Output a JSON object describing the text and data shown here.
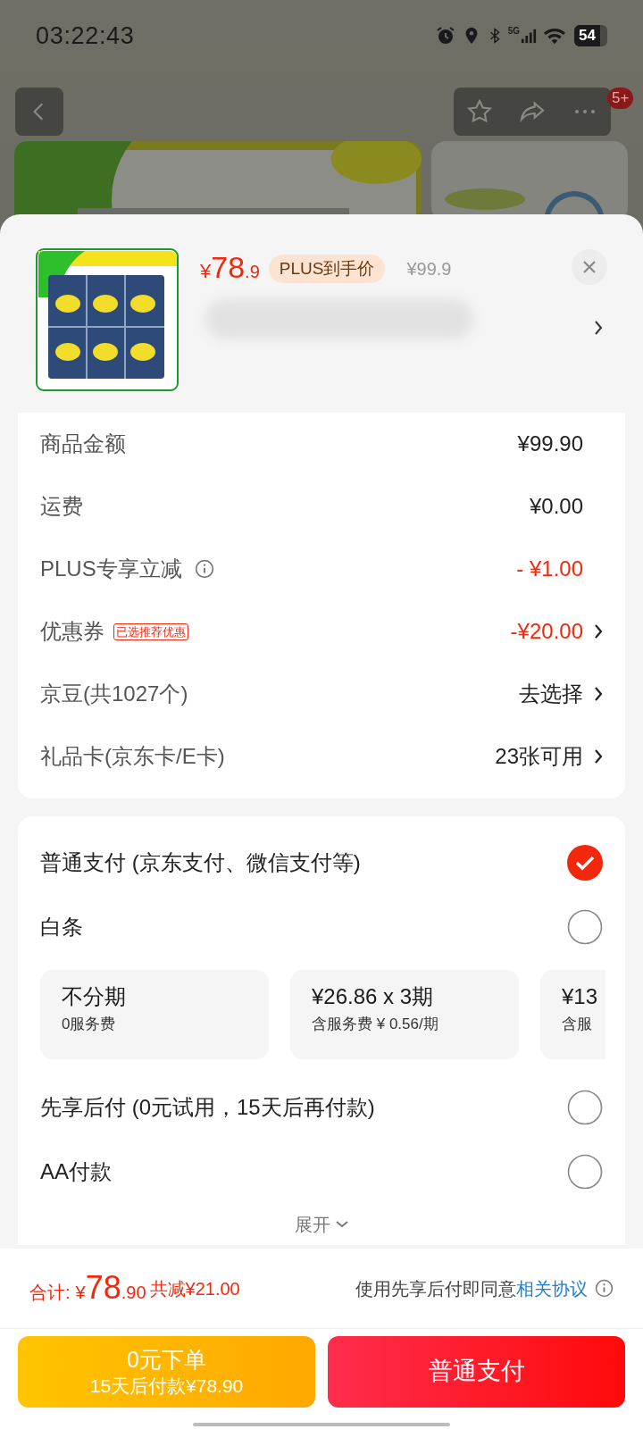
{
  "status_bar": {
    "time": "03:22:43",
    "network": "5G",
    "battery": "54"
  },
  "top_nav": {
    "badge": "5+"
  },
  "product": {
    "price_symbol": "¥",
    "price_main": "78",
    "price_decimal": ".9",
    "plus_tag": "PLUS到手价",
    "original_price": "¥99.9"
  },
  "summary": [
    {
      "label": "商品金额",
      "value": "¥99.90",
      "kind": "amount",
      "chevron": false
    },
    {
      "label": "运费",
      "value": "¥0.00",
      "kind": "amount",
      "chevron": false
    },
    {
      "label": "PLUS专享立减",
      "value": "- ¥1.00",
      "kind": "discount",
      "info": true,
      "chevron": false
    },
    {
      "label": "优惠券",
      "tag": "已选推荐优惠",
      "value": "-¥20.00",
      "kind": "discount",
      "chevron": true
    },
    {
      "label": "京豆(共1027个)",
      "value": "去选择",
      "kind": "amount",
      "chevron": true
    },
    {
      "label": "礼品卡(京东卡/E卡)",
      "value": "23张可用",
      "kind": "amount",
      "chevron": true
    }
  ],
  "payment_methods": [
    {
      "label": "普通支付 (京东支付、微信支付等)",
      "selected": true
    },
    {
      "label": "白条",
      "selected": false,
      "plans": [
        {
          "title": "不分期",
          "subtitle": "0服务费"
        },
        {
          "title": "¥26.86 x 3期",
          "subtitle": "含服务费 ¥ 0.56/期"
        },
        {
          "title": "¥13",
          "subtitle": "含服"
        }
      ]
    },
    {
      "label": "先享后付 (0元试用，15天后再付款)",
      "selected": false
    },
    {
      "label": "AA付款",
      "selected": false
    }
  ],
  "expand": "展开",
  "footer": {
    "total_label": "合计:",
    "total_symbol": "¥",
    "total_main": "78",
    "total_decimal": ".90",
    "saved": "共减¥21.00",
    "agreement": "使用先享后付即同意",
    "agreement_link": "相关协议"
  },
  "buttons": [
    {
      "kind": "later",
      "title": "0元下单",
      "subtitle": "15天后付款¥78.90"
    },
    {
      "kind": "pay",
      "title": "普通支付"
    }
  ]
}
